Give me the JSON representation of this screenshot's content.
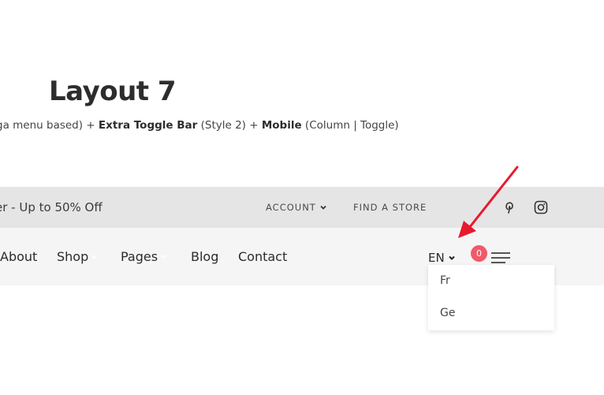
{
  "page": {
    "heading": "Layout 7",
    "subtitle": {
      "part1": "ga menu based) + ",
      "bold1": "Extra Toggle Bar",
      "part2": " (Style 2) + ",
      "bold2": "Mobile",
      "part3": " (Column | Toggle)"
    }
  },
  "topbar": {
    "promo": "er - Up to 50% Off",
    "account_label": "ACCOUNT",
    "find_store_label": "FIND A STORE",
    "social_icons": [
      "pinterest-icon",
      "instagram-icon"
    ]
  },
  "mainnav": {
    "items": [
      {
        "label": "About"
      },
      {
        "label": "Shop"
      },
      {
        "label": "Pages"
      },
      {
        "label": "Blog"
      },
      {
        "label": "Contact"
      }
    ],
    "language": "EN",
    "cart_count": "0"
  },
  "language_dropdown": {
    "options": [
      "Fr",
      "Ge"
    ]
  },
  "annotation": {
    "arrow_color": "#e8192c"
  },
  "colors": {
    "topbar_bg": "#e5e5e5",
    "mainbar_bg": "#f5f5f5",
    "badge": "#f05a6a"
  }
}
